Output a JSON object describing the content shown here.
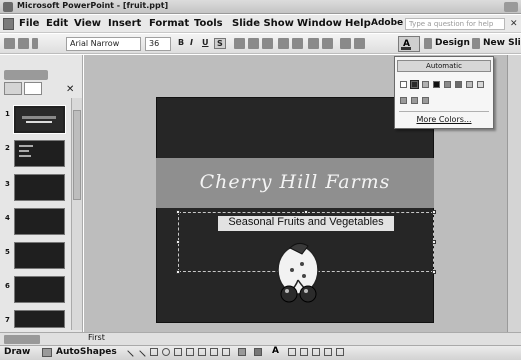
{
  "window": {
    "title": "Microsoft PowerPoint - [fruit.ppt]"
  },
  "menu": {
    "items": [
      "File",
      "Edit",
      "View",
      "Insert",
      "Format",
      "Tools",
      "Slide Show",
      "Window",
      "Help",
      "Adobe PDF"
    ],
    "help_placeholder": "Type a question for help"
  },
  "toolbar": {
    "font_name": "Arial Narrow",
    "font_size": "36",
    "bold": "B",
    "italic": "I",
    "underline": "U",
    "shadow": "S",
    "font_color": "A",
    "design_label": "Design",
    "new_slide_label": "New Slide"
  },
  "slides_pane": {
    "numbers": [
      "1",
      "2",
      "3",
      "4",
      "5",
      "6",
      "7"
    ],
    "selected_index": 1
  },
  "slide": {
    "title": "Cherry Hill Farms",
    "subtitle": "Seasonal Fruits and Vegetables"
  },
  "color_dropdown": {
    "automatic_label": "Automatic",
    "more_colors_label": "More Colors...",
    "row1_colors": [
      "#ffffff",
      "#2a2a2a",
      "#b0b0b0",
      "#111111",
      "#8a8a8a",
      "#6c6c6c",
      "#bdbdbd",
      "#d8d8d8"
    ],
    "row2_colors": [
      "#9a9a9a",
      "#9a9a9a",
      "#9a9a9a"
    ]
  },
  "notes": {
    "text": "First"
  },
  "drawing_toolbar": {
    "draw_label": "Draw",
    "autoshapes_label": "AutoShapes"
  }
}
